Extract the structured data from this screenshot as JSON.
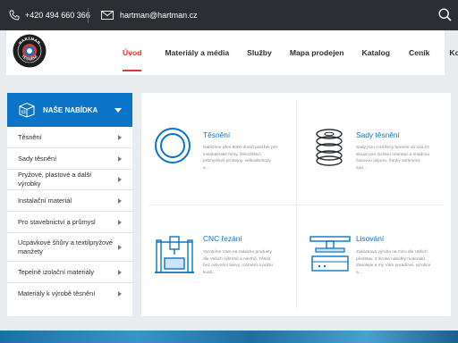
{
  "topbar": {
    "phone": "+420 494 660 366",
    "email": "hartman@hartman.cz",
    "icons": [
      "phone-icon",
      "mail-icon",
      "search-icon"
    ]
  },
  "logo": {
    "brand_text": "HARTMAN TĚSNĚNÍ"
  },
  "nav": {
    "items": [
      {
        "label": "Úvod",
        "active": true
      },
      {
        "label": "Materiály a média",
        "active": false
      },
      {
        "label": "Služby",
        "active": false
      },
      {
        "label": "Mapa prodejen",
        "active": false
      },
      {
        "label": "Katalog",
        "active": false
      },
      {
        "label": "Ceník",
        "active": false
      },
      {
        "label": "Kontakt",
        "active": false
      }
    ]
  },
  "sidebar": {
    "title": "NAŠE NABÍDKA",
    "items": [
      {
        "label": "Těsnění"
      },
      {
        "label": "Sady těsnění"
      },
      {
        "label": "Pryžové, plastové a další výrobky"
      },
      {
        "label": "Instalační materiál"
      },
      {
        "label": "Pro stavebnictví a průmysl"
      },
      {
        "label": "Ucpávkové šňůry a textilpryžové manžety"
      },
      {
        "label": "Tepelně izolační materiály"
      },
      {
        "label": "Materiály k výrobě těsnění"
      }
    ]
  },
  "cards": [
    {
      "title": "Těsnění",
      "text": "Nabízíme přes 9000 druhů položek pro instalatérské firmy, železářství, průmyslové prodejny, velkoobchody a…",
      "icon": "seal-ring-icon"
    },
    {
      "title": "Sady těsnění",
      "text": "Sady jsou rozšířeny bereme do cca 22 skupin pro rychlou orientaci a snadnou časovou úsporu. Široký sortiment sad…",
      "icon": "seal-stack-icon"
    },
    {
      "title": "CNC řezání",
      "text": "Vyrobíme Vám na zakázku produkty dle Vašich výkresů a návrhů. Těsnit bez ovlivnění barvy, rozměrů a počtu kusů…",
      "icon": "cnc-machine-icon"
    },
    {
      "title": "Lisování",
      "text": "Zakázková výroba na míru dle Vašich představ. Z široké nabídky materiálů. Zavolejte a my Vám poradíme, výrobce a…",
      "icon": "press-machine-icon"
    }
  ],
  "colors": {
    "accent_blue": "#0a74c8",
    "accent_red": "#e4362c",
    "topbar": "#2b2e33",
    "background": "#e9ecef"
  }
}
